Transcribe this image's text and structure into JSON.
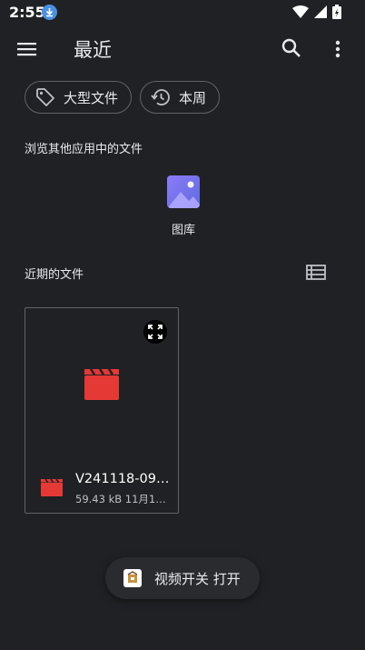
{
  "status_bar": {
    "time": "2:55"
  },
  "app_bar": {
    "title": "最近"
  },
  "chips": [
    {
      "label": "大型文件",
      "icon": "tag-icon"
    },
    {
      "label": "本周",
      "icon": "history-icon"
    }
  ],
  "browse_section": {
    "label": "浏览其他应用中的文件"
  },
  "apps": [
    {
      "label": "图库",
      "icon": "gallery-icon"
    }
  ],
  "recent_section": {
    "label": "近期的文件"
  },
  "files": [
    {
      "name": "V241118-09…",
      "meta": "59.43 kB 11月1…"
    }
  ],
  "toast": {
    "text": "视频开关 打开"
  },
  "colors": {
    "background": "#202124",
    "clapper": "#e53935",
    "gallery": "#7b73f0"
  }
}
